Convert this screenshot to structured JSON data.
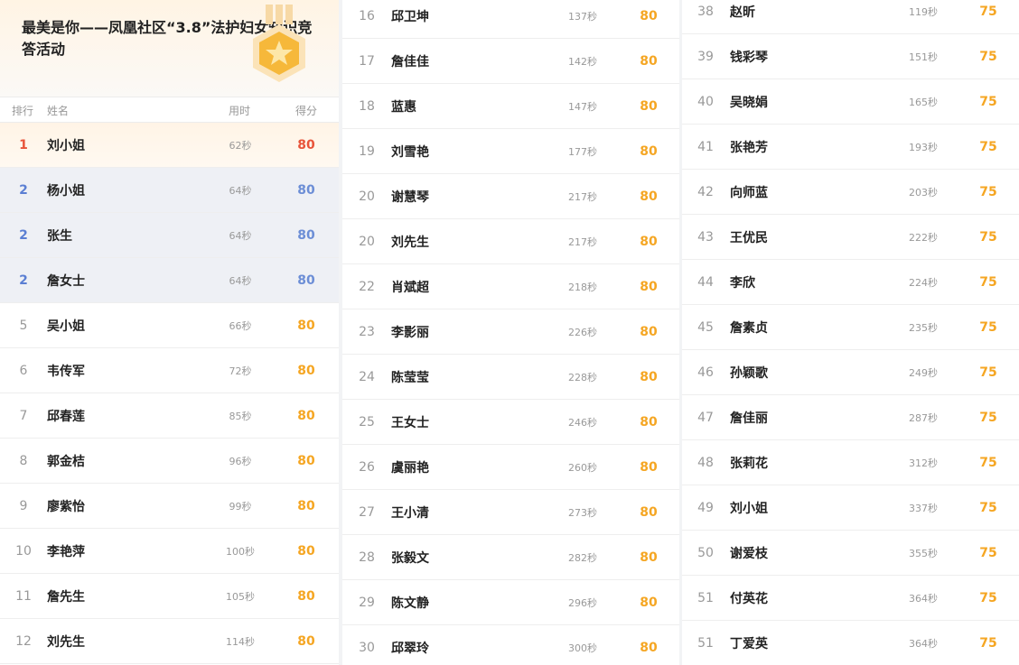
{
  "title": "最美是你——凤凰社区“3.8”法护妇女知识竞答活动",
  "headers": {
    "rank": "排行",
    "name": "姓名",
    "time": "用时",
    "score": "得分"
  },
  "colors": {
    "gold": "#e8543a",
    "silver": "#6c8ed6",
    "score": "#f5a623"
  },
  "columns": [
    [
      {
        "rank": "1",
        "name": "刘小姐",
        "time": "62秒",
        "score": "80",
        "tier": "gold"
      },
      {
        "rank": "2",
        "name": "杨小姐",
        "time": "64秒",
        "score": "80",
        "tier": "silver"
      },
      {
        "rank": "2",
        "name": "张生",
        "time": "64秒",
        "score": "80",
        "tier": "silver"
      },
      {
        "rank": "2",
        "name": "詹女士",
        "time": "64秒",
        "score": "80",
        "tier": "silver"
      },
      {
        "rank": "5",
        "name": "吴小姐",
        "time": "66秒",
        "score": "80"
      },
      {
        "rank": "6",
        "name": "韦传军",
        "time": "72秒",
        "score": "80"
      },
      {
        "rank": "7",
        "name": "邱春莲",
        "time": "85秒",
        "score": "80"
      },
      {
        "rank": "8",
        "name": "郭金桔",
        "time": "96秒",
        "score": "80"
      },
      {
        "rank": "9",
        "name": "廖紫怡",
        "time": "99秒",
        "score": "80"
      },
      {
        "rank": "10",
        "name": "李艳萍",
        "time": "100秒",
        "score": "80"
      },
      {
        "rank": "11",
        "name": "詹先生",
        "time": "105秒",
        "score": "80"
      },
      {
        "rank": "12",
        "name": "刘先生",
        "time": "114秒",
        "score": "80"
      }
    ],
    [
      {
        "rank": "16",
        "name": "邱卫坤",
        "time": "137秒",
        "score": "80"
      },
      {
        "rank": "17",
        "name": "詹佳佳",
        "time": "142秒",
        "score": "80"
      },
      {
        "rank": "18",
        "name": "蓝惠",
        "time": "147秒",
        "score": "80"
      },
      {
        "rank": "19",
        "name": "刘雪艳",
        "time": "177秒",
        "score": "80"
      },
      {
        "rank": "20",
        "name": "谢慧琴",
        "time": "217秒",
        "score": "80"
      },
      {
        "rank": "20",
        "name": "刘先生",
        "time": "217秒",
        "score": "80"
      },
      {
        "rank": "22",
        "name": "肖斌超",
        "time": "218秒",
        "score": "80"
      },
      {
        "rank": "23",
        "name": "李影丽",
        "time": "226秒",
        "score": "80"
      },
      {
        "rank": "24",
        "name": "陈莹莹",
        "time": "228秒",
        "score": "80"
      },
      {
        "rank": "25",
        "name": "王女士",
        "time": "246秒",
        "score": "80"
      },
      {
        "rank": "26",
        "name": "虞丽艳",
        "time": "260秒",
        "score": "80"
      },
      {
        "rank": "27",
        "name": "王小清",
        "time": "273秒",
        "score": "80"
      },
      {
        "rank": "28",
        "name": "张毅文",
        "time": "282秒",
        "score": "80"
      },
      {
        "rank": "29",
        "name": "陈文静",
        "time": "296秒",
        "score": "80"
      },
      {
        "rank": "30",
        "name": "邱翠玲",
        "time": "300秒",
        "score": "80"
      }
    ],
    [
      {
        "rank": "38",
        "name": "赵昕",
        "time": "119秒",
        "score": "75"
      },
      {
        "rank": "39",
        "name": "钱彩琴",
        "time": "151秒",
        "score": "75"
      },
      {
        "rank": "40",
        "name": "吴晓娟",
        "time": "165秒",
        "score": "75"
      },
      {
        "rank": "41",
        "name": "张艳芳",
        "time": "193秒",
        "score": "75"
      },
      {
        "rank": "42",
        "name": "向师蓝",
        "time": "203秒",
        "score": "75"
      },
      {
        "rank": "43",
        "name": "王优民",
        "time": "222秒",
        "score": "75"
      },
      {
        "rank": "44",
        "name": "李欣",
        "time": "224秒",
        "score": "75"
      },
      {
        "rank": "45",
        "name": "詹素贞",
        "time": "235秒",
        "score": "75"
      },
      {
        "rank": "46",
        "name": "孙颖歌",
        "time": "249秒",
        "score": "75"
      },
      {
        "rank": "47",
        "name": "詹佳丽",
        "time": "287秒",
        "score": "75"
      },
      {
        "rank": "48",
        "name": "张莉花",
        "time": "312秒",
        "score": "75"
      },
      {
        "rank": "49",
        "name": "刘小姐",
        "time": "337秒",
        "score": "75"
      },
      {
        "rank": "50",
        "name": "谢爱枝",
        "time": "355秒",
        "score": "75"
      },
      {
        "rank": "51",
        "name": "付英花",
        "time": "364秒",
        "score": "75"
      },
      {
        "rank": "51",
        "name": "丁爱英",
        "time": "364秒",
        "score": "75"
      }
    ]
  ]
}
